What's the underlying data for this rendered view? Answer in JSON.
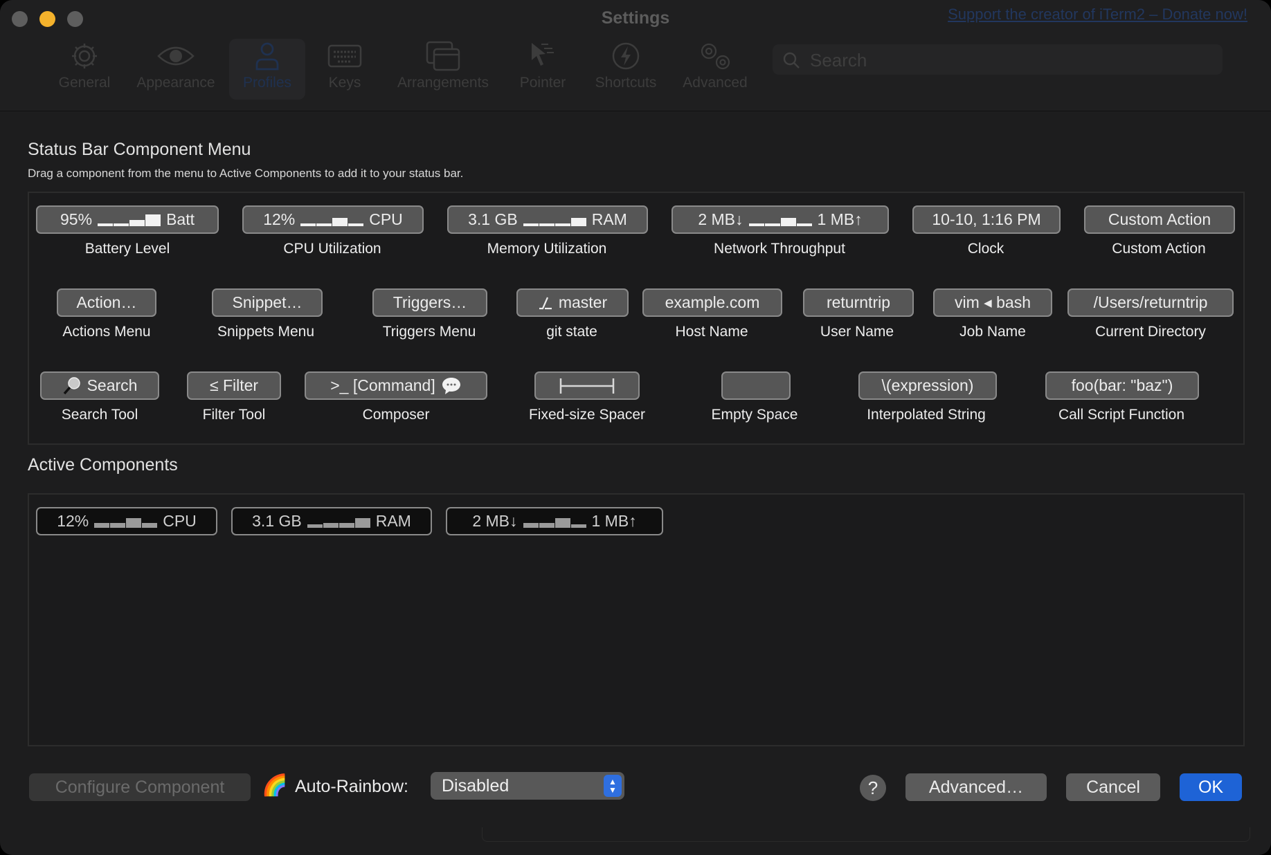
{
  "window": {
    "title": "Settings",
    "donate_link": "Support the creator of iTerm2 – Donate now!",
    "traffic_lights": {
      "close": "#5e5e5e",
      "minimize": "#f4b22c",
      "zoom": "#5e5e5e"
    }
  },
  "toolbar": {
    "items": [
      {
        "label": "General",
        "icon": "gear-icon"
      },
      {
        "label": "Appearance",
        "icon": "eye-icon"
      },
      {
        "label": "Profiles",
        "icon": "person-icon",
        "selected": true
      },
      {
        "label": "Keys",
        "icon": "keyboard-icon"
      },
      {
        "label": "Arrangements",
        "icon": "windows-icon"
      },
      {
        "label": "Pointer",
        "icon": "pointer-icon"
      },
      {
        "label": "Shortcuts",
        "icon": "bolt-icon"
      },
      {
        "label": "Advanced",
        "icon": "gears-icon"
      }
    ],
    "search_placeholder": "Search"
  },
  "menu": {
    "title": "Status Bar Component Menu",
    "subtitle": "Drag a component from the menu to Active Components to add it to your status bar.",
    "components": [
      {
        "chip_left": "95%",
        "chip_right": "Batt",
        "spark": [
          0.2,
          0.2,
          0.45,
          0.85,
          0.85
        ],
        "label": "Battery Level"
      },
      {
        "chip_left": "12%",
        "chip_right": "CPU",
        "spark": [
          0.2,
          0.2,
          0.6,
          0.2
        ],
        "label": "CPU Utilization"
      },
      {
        "chip_left": "3.1 GB",
        "chip_right": "RAM",
        "spark": [
          0.2,
          0.2,
          0.2,
          0.6
        ],
        "label": "Memory Utilization"
      },
      {
        "chip_left": "2 MB↓",
        "chip_right": "1 MB↑",
        "spark": [
          0.2,
          0.2,
          0.6,
          0.2
        ],
        "label": "Network Throughput"
      },
      {
        "chip_text": "10-10, 1:16 PM",
        "label": "Clock"
      },
      {
        "chip_text": "Custom Action",
        "label": "Custom Action"
      },
      {
        "chip_text": "Action…",
        "label": "Actions Menu"
      },
      {
        "chip_text": "Snippet…",
        "label": "Snippets Menu"
      },
      {
        "chip_text": "Triggers…",
        "label": "Triggers Menu"
      },
      {
        "chip_text": "master",
        "chip_icon": "git-branch-icon",
        "label": "git state"
      },
      {
        "chip_text": "example.com",
        "label": "Host Name"
      },
      {
        "chip_text": "returntrip",
        "label": "User Name"
      },
      {
        "chip_text": "vim ◂ bash",
        "label": "Job Name"
      },
      {
        "chip_text": "/Users/returntrip",
        "label": "Current Directory"
      },
      {
        "chip_text": "Search",
        "chip_icon": "magnifier-icon",
        "label": "Search Tool"
      },
      {
        "chip_text": "≤ Filter",
        "label": "Filter Tool"
      },
      {
        "chip_text": ">_ [Command]",
        "chip_icon": "speech-bubble-icon",
        "label": "Composer"
      },
      {
        "chip_text": "",
        "chip_icon": "spacer-icon",
        "label": "Fixed-size Spacer"
      },
      {
        "chip_text": "",
        "label": "Empty Space"
      },
      {
        "chip_text": "\\(expression)",
        "label": "Interpolated String"
      },
      {
        "chip_text": "foo(bar: \"baz\")",
        "label": "Call Script Function"
      }
    ]
  },
  "active": {
    "title": "Active Components",
    "components": [
      {
        "chip_left": "12%",
        "chip_right": "CPU"
      },
      {
        "chip_left": "3.1 GB",
        "chip_right": "RAM"
      },
      {
        "chip_left": "2 MB↓",
        "chip_right": "1 MB↑"
      }
    ]
  },
  "footer": {
    "configure_label": "Configure Component",
    "rainbow_icon": "🌈",
    "auto_rainbow_label": "Auto-Rainbow:",
    "auto_rainbow_value": "Disabled",
    "help_label": "?",
    "advanced_label": "Advanced…",
    "cancel_label": "Cancel",
    "ok_label": "OK",
    "accent": "#1e63d6"
  }
}
